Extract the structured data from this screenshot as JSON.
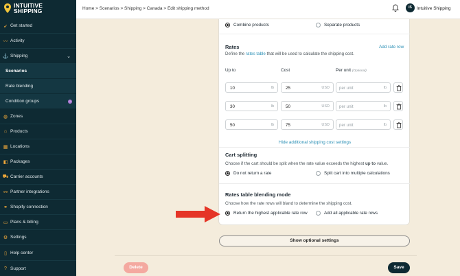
{
  "brand": {
    "name_line1": "INTUITIVE",
    "name_line2": "SHIPPING"
  },
  "sidebar": {
    "items": [
      {
        "label": "Get started",
        "icon": "rocket-icon"
      },
      {
        "label": "Activity",
        "icon": "activity-icon"
      },
      {
        "label": "Shipping",
        "icon": "shipping-icon"
      },
      {
        "label": "Scenarios"
      },
      {
        "label": "Rate blending"
      },
      {
        "label": "Condition groups",
        "badge": "!"
      },
      {
        "label": "Zones",
        "icon": "globe-icon"
      },
      {
        "label": "Products",
        "icon": "tag-icon"
      },
      {
        "label": "Locations",
        "icon": "building-icon"
      },
      {
        "label": "Packages",
        "icon": "box-icon"
      },
      {
        "label": "Carrier accounts",
        "icon": "truck-icon"
      },
      {
        "label": "Partner integrations",
        "icon": "connect-icon"
      },
      {
        "label": "Shopify connection",
        "icon": "shop-icon"
      },
      {
        "label": "Plans & billing",
        "icon": "card-icon"
      },
      {
        "label": "Settings",
        "icon": "gear-icon"
      }
    ],
    "bottom": [
      {
        "label": "Help center",
        "icon": "help-icon"
      },
      {
        "label": "Support",
        "icon": "support-icon"
      }
    ]
  },
  "header": {
    "breadcrumb": "Home > Scenarios > Shipping > Canada > Edit shipping method",
    "user_initials": "IS",
    "user_name": "Intuitive Shipping"
  },
  "card": {
    "combine": {
      "option1": "Combine products",
      "option2": "Separate products"
    },
    "rates": {
      "title": "Rates",
      "add_link": "Add rate row",
      "desc_pre": "Define the ",
      "desc_link": "rates table",
      "desc_post": " that will be used to calculate the shipping cost.",
      "col_upto": "Up to",
      "col_cost": "Cost",
      "col_per_unit": "Per unit",
      "col_optional": "(Optional)",
      "rows": [
        {
          "upto": "10",
          "upto_unit": "lb",
          "cost": "25",
          "cost_unit": "USD",
          "per_unit_ph": "per unit",
          "per_unit_unit": "lb"
        },
        {
          "upto": "30",
          "upto_unit": "lb",
          "cost": "50",
          "cost_unit": "USD",
          "per_unit_ph": "per unit",
          "per_unit_unit": "lb"
        },
        {
          "upto": "50",
          "upto_unit": "lb",
          "cost": "75",
          "cost_unit": "USD",
          "per_unit_ph": "per unit",
          "per_unit_unit": "lb"
        }
      ],
      "hide_link": "Hide additional shipping cost settings"
    },
    "cart": {
      "title": "Cart splitting",
      "desc_pre": "Choose if the cart should be split when the rate value exceeds the highest ",
      "desc_bold": "up to",
      "desc_post": " value.",
      "option1": "Do not return a rate",
      "option2": "Split cart into multiple calculations"
    },
    "blend": {
      "title": "Rates table blending mode",
      "desc": "Choose how the rate rows will bland to determine the shipping cost.",
      "option1": "Return the highest applicable rate row",
      "option2": "Add all applicable rate rows"
    }
  },
  "optional_settings_label": "Show optional settings",
  "footer": {
    "delete_label": "Delete",
    "save_label": "Save"
  },
  "colors": {
    "sidebar": "#0e2a33",
    "accent_icon": "#f1a93a",
    "link": "#2a8fb5",
    "arrow": "#e53527",
    "delete": "#f4a9a0",
    "background": "#f4ecdc"
  }
}
